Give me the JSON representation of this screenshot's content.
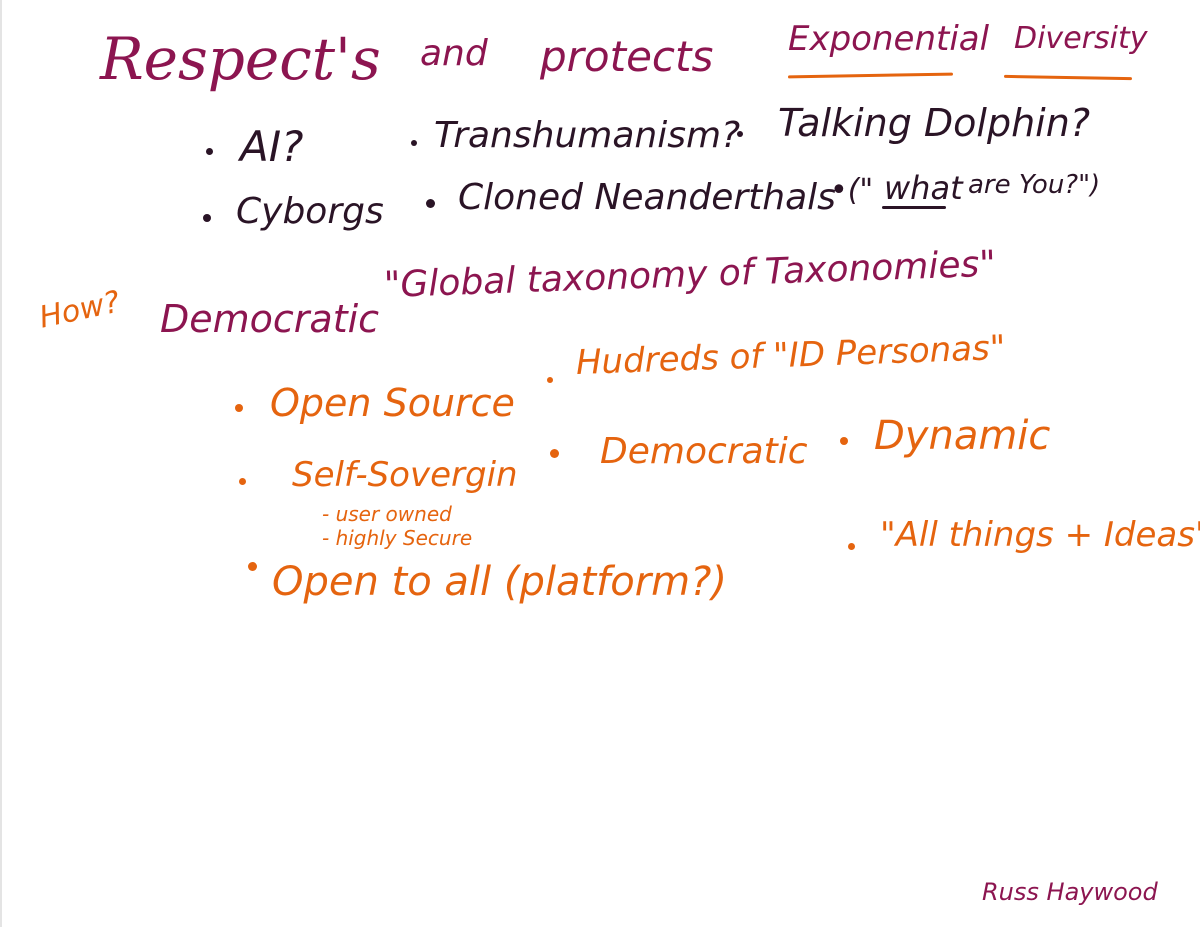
{
  "title": {
    "word1": "Respect's",
    "word2": "and",
    "word3": "protects",
    "word4": "Exponential",
    "word5": "Diversity"
  },
  "examples": [
    "AI?",
    "Transhumanism?",
    "Talking Dolphin?",
    "Cyborgs",
    "Cloned Neanderthals"
  ],
  "aside": {
    "open": "•(\"",
    "what": "what",
    "rest": "are You?\")"
  },
  "how": {
    "label": "How?",
    "democratic": "Democratic",
    "global": "\"Global taxonomy of Taxonomies\""
  },
  "features": {
    "open_source": "Open Source",
    "self_sovereign": "Self-Sovergin",
    "user_owned": "- user owned",
    "highly_secure": "- highly Secure",
    "open_to_all": "Open to all (platform?)",
    "hundreds": "Hudreds of \"ID Personas\"",
    "democratic": "Democratic",
    "dynamic": "Dynamic",
    "all_things": "\"All things + Ideas\""
  },
  "signature": "Russ Haywood",
  "colors": {
    "maroon": "#8c1550",
    "dark": "#2a1426",
    "orange": "#e5640f"
  }
}
